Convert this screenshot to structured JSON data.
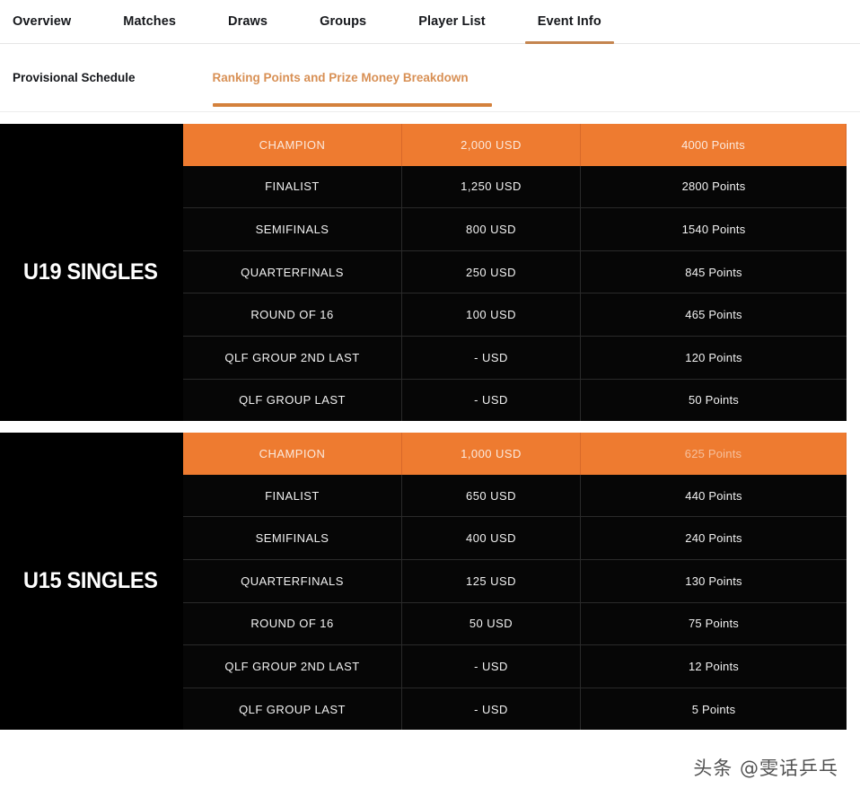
{
  "primary_nav": {
    "tabs": [
      {
        "label": "Overview",
        "active": false
      },
      {
        "label": "Matches",
        "active": false
      },
      {
        "label": "Draws",
        "active": false
      },
      {
        "label": "Groups",
        "active": false
      },
      {
        "label": "Player List",
        "active": false
      },
      {
        "label": "Event Info",
        "active": true
      }
    ]
  },
  "secondary_nav": {
    "tabs": [
      {
        "label": "Provisional Schedule",
        "active": false
      },
      {
        "label": "Ranking Points and Prize Money Breakdown",
        "active": true
      }
    ]
  },
  "colors": {
    "accent_orange": "#EE7B30",
    "underline_primary": "#C4854F",
    "underline_secondary": "#D4813C",
    "table_background": "#060606",
    "category_background": "#000000"
  },
  "tables": [
    {
      "category": "U19 SINGLES",
      "rows": [
        {
          "stage": "CHAMPION",
          "money": "2,000 USD",
          "points": "4000 Points",
          "highlight": true
        },
        {
          "stage": "FINALIST",
          "money": "1,250 USD",
          "points": "2800 Points",
          "highlight": false
        },
        {
          "stage": "SEMIFINALS",
          "money": "800 USD",
          "points": "1540 Points",
          "highlight": false
        },
        {
          "stage": "QUARTERFINALS",
          "money": "250 USD",
          "points": "845 Points",
          "highlight": false
        },
        {
          "stage": "ROUND OF 16",
          "money": "100 USD",
          "points": "465 Points",
          "highlight": false
        },
        {
          "stage": "QLF GROUP 2ND LAST",
          "money": "- USD",
          "points": "120 Points",
          "highlight": false
        },
        {
          "stage": "QLF GROUP LAST",
          "money": "- USD",
          "points": "50 Points",
          "highlight": false
        }
      ]
    },
    {
      "category": "U15 SINGLES",
      "rows": [
        {
          "stage": "CHAMPION",
          "money": "1,000 USD",
          "points": "625 Points",
          "highlight": true,
          "points_faded": true
        },
        {
          "stage": "FINALIST",
          "money": "650 USD",
          "points": "440 Points",
          "highlight": false
        },
        {
          "stage": "SEMIFINALS",
          "money": "400 USD",
          "points": "240 Points",
          "highlight": false
        },
        {
          "stage": "QUARTERFINALS",
          "money": "125 USD",
          "points": "130 Points",
          "highlight": false
        },
        {
          "stage": "ROUND OF 16",
          "money": "50 USD",
          "points": "75 Points",
          "highlight": false
        },
        {
          "stage": "QLF GROUP 2ND LAST",
          "money": "- USD",
          "points": "12 Points",
          "highlight": false
        },
        {
          "stage": "QLF GROUP LAST",
          "money": "- USD",
          "points": "5 Points",
          "highlight": false
        }
      ]
    }
  ],
  "watermark": {
    "text": "头条 @雯话乒乓"
  }
}
